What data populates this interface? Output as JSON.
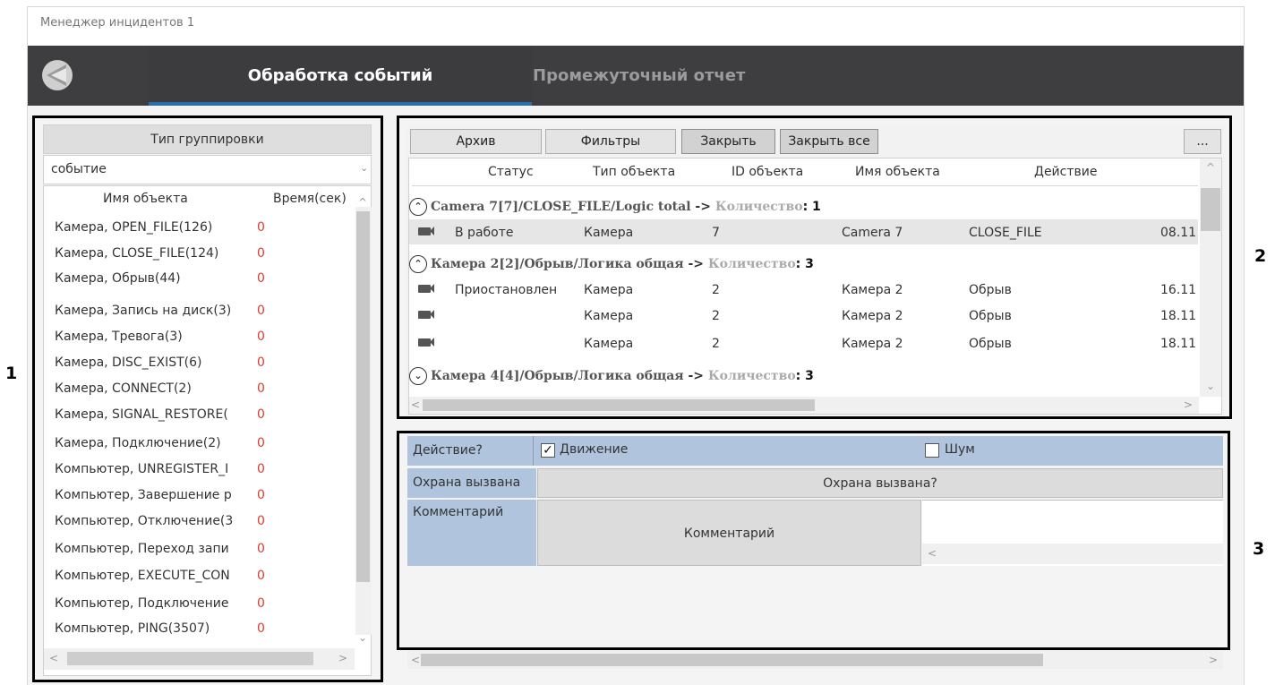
{
  "window": {
    "title": "Менеджер инцидентов 1"
  },
  "tabs": [
    {
      "label": "Обработка событий",
      "active": true
    },
    {
      "label": "Промежуточный отчет",
      "active": false
    }
  ],
  "callouts": [
    "1",
    "2",
    "3"
  ],
  "left_panel": {
    "group_header": "Тип группировки",
    "group_select_value": "событие",
    "columns": [
      "Имя объекта",
      "Время(сек)"
    ],
    "rows": [
      {
        "name": "Камера, OPEN_FILE(126)",
        "time": "0"
      },
      {
        "name": "Камера, CLOSE_FILE(124)",
        "time": "0"
      },
      {
        "name": "Камера, Обрыв(44)",
        "time": "0"
      },
      {
        "name": "Камера, Запись на диск(3)",
        "time": "0"
      },
      {
        "name": "Камера, Тревога(3)",
        "time": "0"
      },
      {
        "name": "Камера, DISC_EXIST(6)",
        "time": "0"
      },
      {
        "name": "Камера, CONNECT(2)",
        "time": "0"
      },
      {
        "name": "Камера, SIGNAL_RESTORE(",
        "time": "0"
      },
      {
        "name": "Камера, Подключение(2)",
        "time": "0"
      },
      {
        "name": "Компьютер, UNREGISTER_I",
        "time": "0"
      },
      {
        "name": "Компьютер, Завершение р",
        "time": "0"
      },
      {
        "name": "Компьютер, Отключение(3",
        "time": "0"
      },
      {
        "name": "Компьютер, Переход запи",
        "time": "0"
      },
      {
        "name": "Компьютер, EXECUTE_CON",
        "time": "0"
      },
      {
        "name": "Компьютер, Подключение",
        "time": "0"
      },
      {
        "name": "Компьютер, PING(3507)",
        "time": "0"
      }
    ]
  },
  "events_panel": {
    "toolbar": {
      "archive": "Архив",
      "filters": "Фильтры",
      "close": "Закрыть",
      "close_all": "Закрыть все",
      "more": "..."
    },
    "columns": [
      "Статус",
      "Тип объекта",
      "ID объекта",
      "Имя объекта",
      "Действие"
    ],
    "groups": [
      {
        "title": "Camera 7[7]/CLOSE_FILE/Logic total",
        "arrow": "->",
        "count_label": "Количество",
        "count": ": 1",
        "expanded": true,
        "rows": [
          {
            "status": "В работе",
            "type": "Камера",
            "id": "7",
            "name": "Camera 7",
            "action": "CLOSE_FILE",
            "date": "08.11"
          }
        ]
      },
      {
        "title": "Камера 2[2]/Обрыв/Логика общая",
        "arrow": "->",
        "count_label": "Количество",
        "count": ": 3",
        "expanded": true,
        "rows": [
          {
            "status": "Приостановлен",
            "type": "Камера",
            "id": "2",
            "name": "Камера 2",
            "action": "Обрыв",
            "date": "16.11"
          },
          {
            "status": "",
            "type": "Камера",
            "id": "2",
            "name": "Камера 2",
            "action": "Обрыв",
            "date": "18.11"
          },
          {
            "status": "",
            "type": "Камера",
            "id": "2",
            "name": "Камера 2",
            "action": "Обрыв",
            "date": "18.11"
          }
        ]
      },
      {
        "title": "Камера 4[4]/Обрыв/Логика общая",
        "arrow": "->",
        "count_label": "Количество",
        "count": ": 3",
        "expanded": false,
        "rows": []
      }
    ]
  },
  "form_panel": {
    "action_label": "Действие?",
    "checkbox_motion": {
      "label": "Движение",
      "checked": true
    },
    "checkbox_noise": {
      "label": "Шум",
      "checked": false
    },
    "guard_label": "Охрана вызвана",
    "guard_button": "Охрана вызвана?",
    "comment_label": "Комментарий",
    "comment_button": "Комментарий"
  },
  "colors": {
    "navbar": "#3e3e40",
    "tab_accent": "#2a6ead",
    "form_header": "#b0c4de",
    "zero_value": "#e03a2f"
  },
  "icons": {
    "logo": "app-logo-icon",
    "camera": "camera-icon",
    "expand": "chevron-up-circle-icon",
    "collapse": "chevron-down-circle-icon"
  }
}
